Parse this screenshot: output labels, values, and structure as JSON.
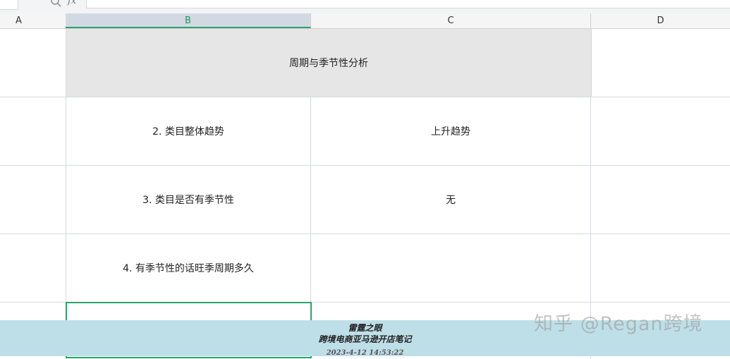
{
  "formula_bar": {
    "fx_label": "fx",
    "value": ""
  },
  "columns": [
    "A",
    "B",
    "C",
    "D"
  ],
  "active_column": "B",
  "sheet": {
    "title": "周期与季节性分析",
    "rows": [
      {
        "label": "2.  类目整体趋势",
        "value": "上升趋势"
      },
      {
        "label": "3.  类目是否有季节性",
        "value": "无"
      },
      {
        "label": "4.  有季节性的话旺季周期多久",
        "value": ""
      }
    ]
  },
  "watermark": {
    "line1": "雷霆之眼",
    "line2": "跨境电商亚马逊开店笔记",
    "line3": "2023-4-12 14:53:22",
    "zhihu": "知乎 @Regan跨境"
  }
}
